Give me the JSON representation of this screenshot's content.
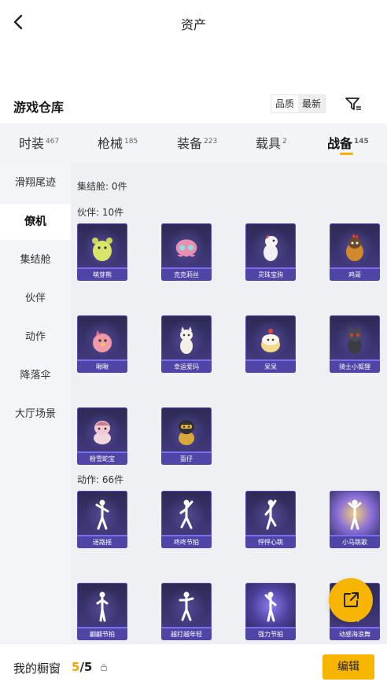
{
  "header": {
    "title": "资产"
  },
  "warehouse": {
    "title": "游戏仓库",
    "sort_quality": "品质",
    "sort_latest": "最新"
  },
  "tabs": [
    {
      "label": "时装",
      "count": "467"
    },
    {
      "label": "枪械",
      "count": "185"
    },
    {
      "label": "装备",
      "count": "223"
    },
    {
      "label": "载具",
      "count": "2"
    },
    {
      "label": "战备",
      "count": "145"
    }
  ],
  "sidebar": {
    "items": [
      {
        "label": "滑翔尾迹"
      },
      {
        "label": "僚机"
      },
      {
        "label": "集结舱"
      },
      {
        "label": "伙伴"
      },
      {
        "label": "动作"
      },
      {
        "label": "降落伞"
      },
      {
        "label": "大厅场景"
      }
    ]
  },
  "content": {
    "assembly_label": "集结舱: 0件",
    "partner_label": "伙伴: 10件",
    "action_label": "动作: 66件",
    "partners": [
      {
        "name": "萌芽熊"
      },
      {
        "name": "克克莉丝"
      },
      {
        "name": "灵珠宝驹"
      },
      {
        "name": "鸡哥"
      },
      {
        "name": "啾啾"
      },
      {
        "name": "幸运爱玛"
      },
      {
        "name": "呆呆"
      },
      {
        "name": "骑士小狐狸"
      },
      {
        "name": "粉雪蛇宝"
      },
      {
        "name": "盔仔"
      }
    ],
    "actions": [
      {
        "name": "迷路摇"
      },
      {
        "name": "咚咚节拍"
      },
      {
        "name": "怦怦心跳"
      },
      {
        "name": "小马跳歌"
      },
      {
        "name": "翩翩节拍"
      },
      {
        "name": "越打越年轻"
      },
      {
        "name": "强力节拍"
      },
      {
        "name": "动感海浪舞"
      }
    ]
  },
  "bottom": {
    "window_label": "我的橱窗",
    "current": "5",
    "separator": "/",
    "total": "5",
    "edit_label": "编辑"
  },
  "colors": {
    "accent": "#f7b500",
    "card_bg": "#3a3470",
    "card_label": "#4f45a6"
  },
  "icons": [
    "back-arrow-icon",
    "filter-icon",
    "share-icon",
    "lock-icon"
  ]
}
